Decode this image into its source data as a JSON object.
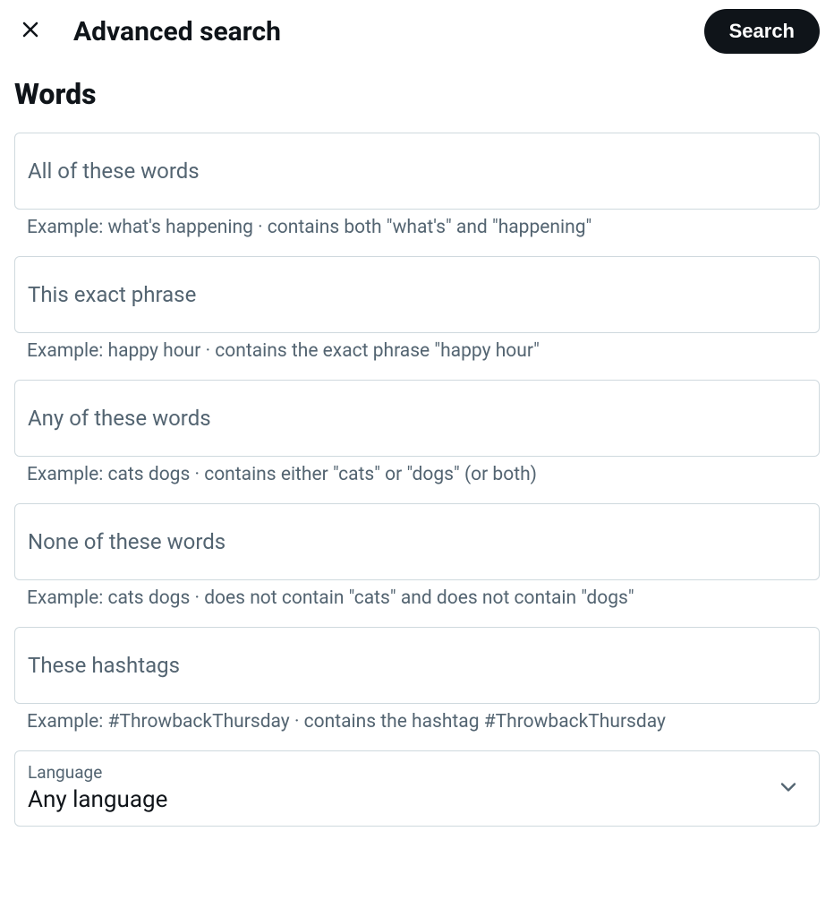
{
  "header": {
    "title": "Advanced search",
    "search_button": "Search"
  },
  "section": {
    "words_title": "Words"
  },
  "fields": {
    "all_words": {
      "placeholder": "All of these words",
      "helper": "Example: what's happening · contains both \"what's\" and \"happening\""
    },
    "exact_phrase": {
      "placeholder": "This exact phrase",
      "helper": "Example: happy hour · contains the exact phrase \"happy hour\""
    },
    "any_words": {
      "placeholder": "Any of these words",
      "helper": "Example: cats dogs · contains either \"cats\" or \"dogs\" (or both)"
    },
    "none_words": {
      "placeholder": "None of these words",
      "helper": "Example: cats dogs · does not contain \"cats\" and does not contain \"dogs\""
    },
    "hashtags": {
      "placeholder": "These hashtags",
      "helper": "Example: #ThrowbackThursday · contains the hashtag #ThrowbackThursday"
    },
    "language": {
      "label": "Language",
      "value": "Any language"
    }
  }
}
